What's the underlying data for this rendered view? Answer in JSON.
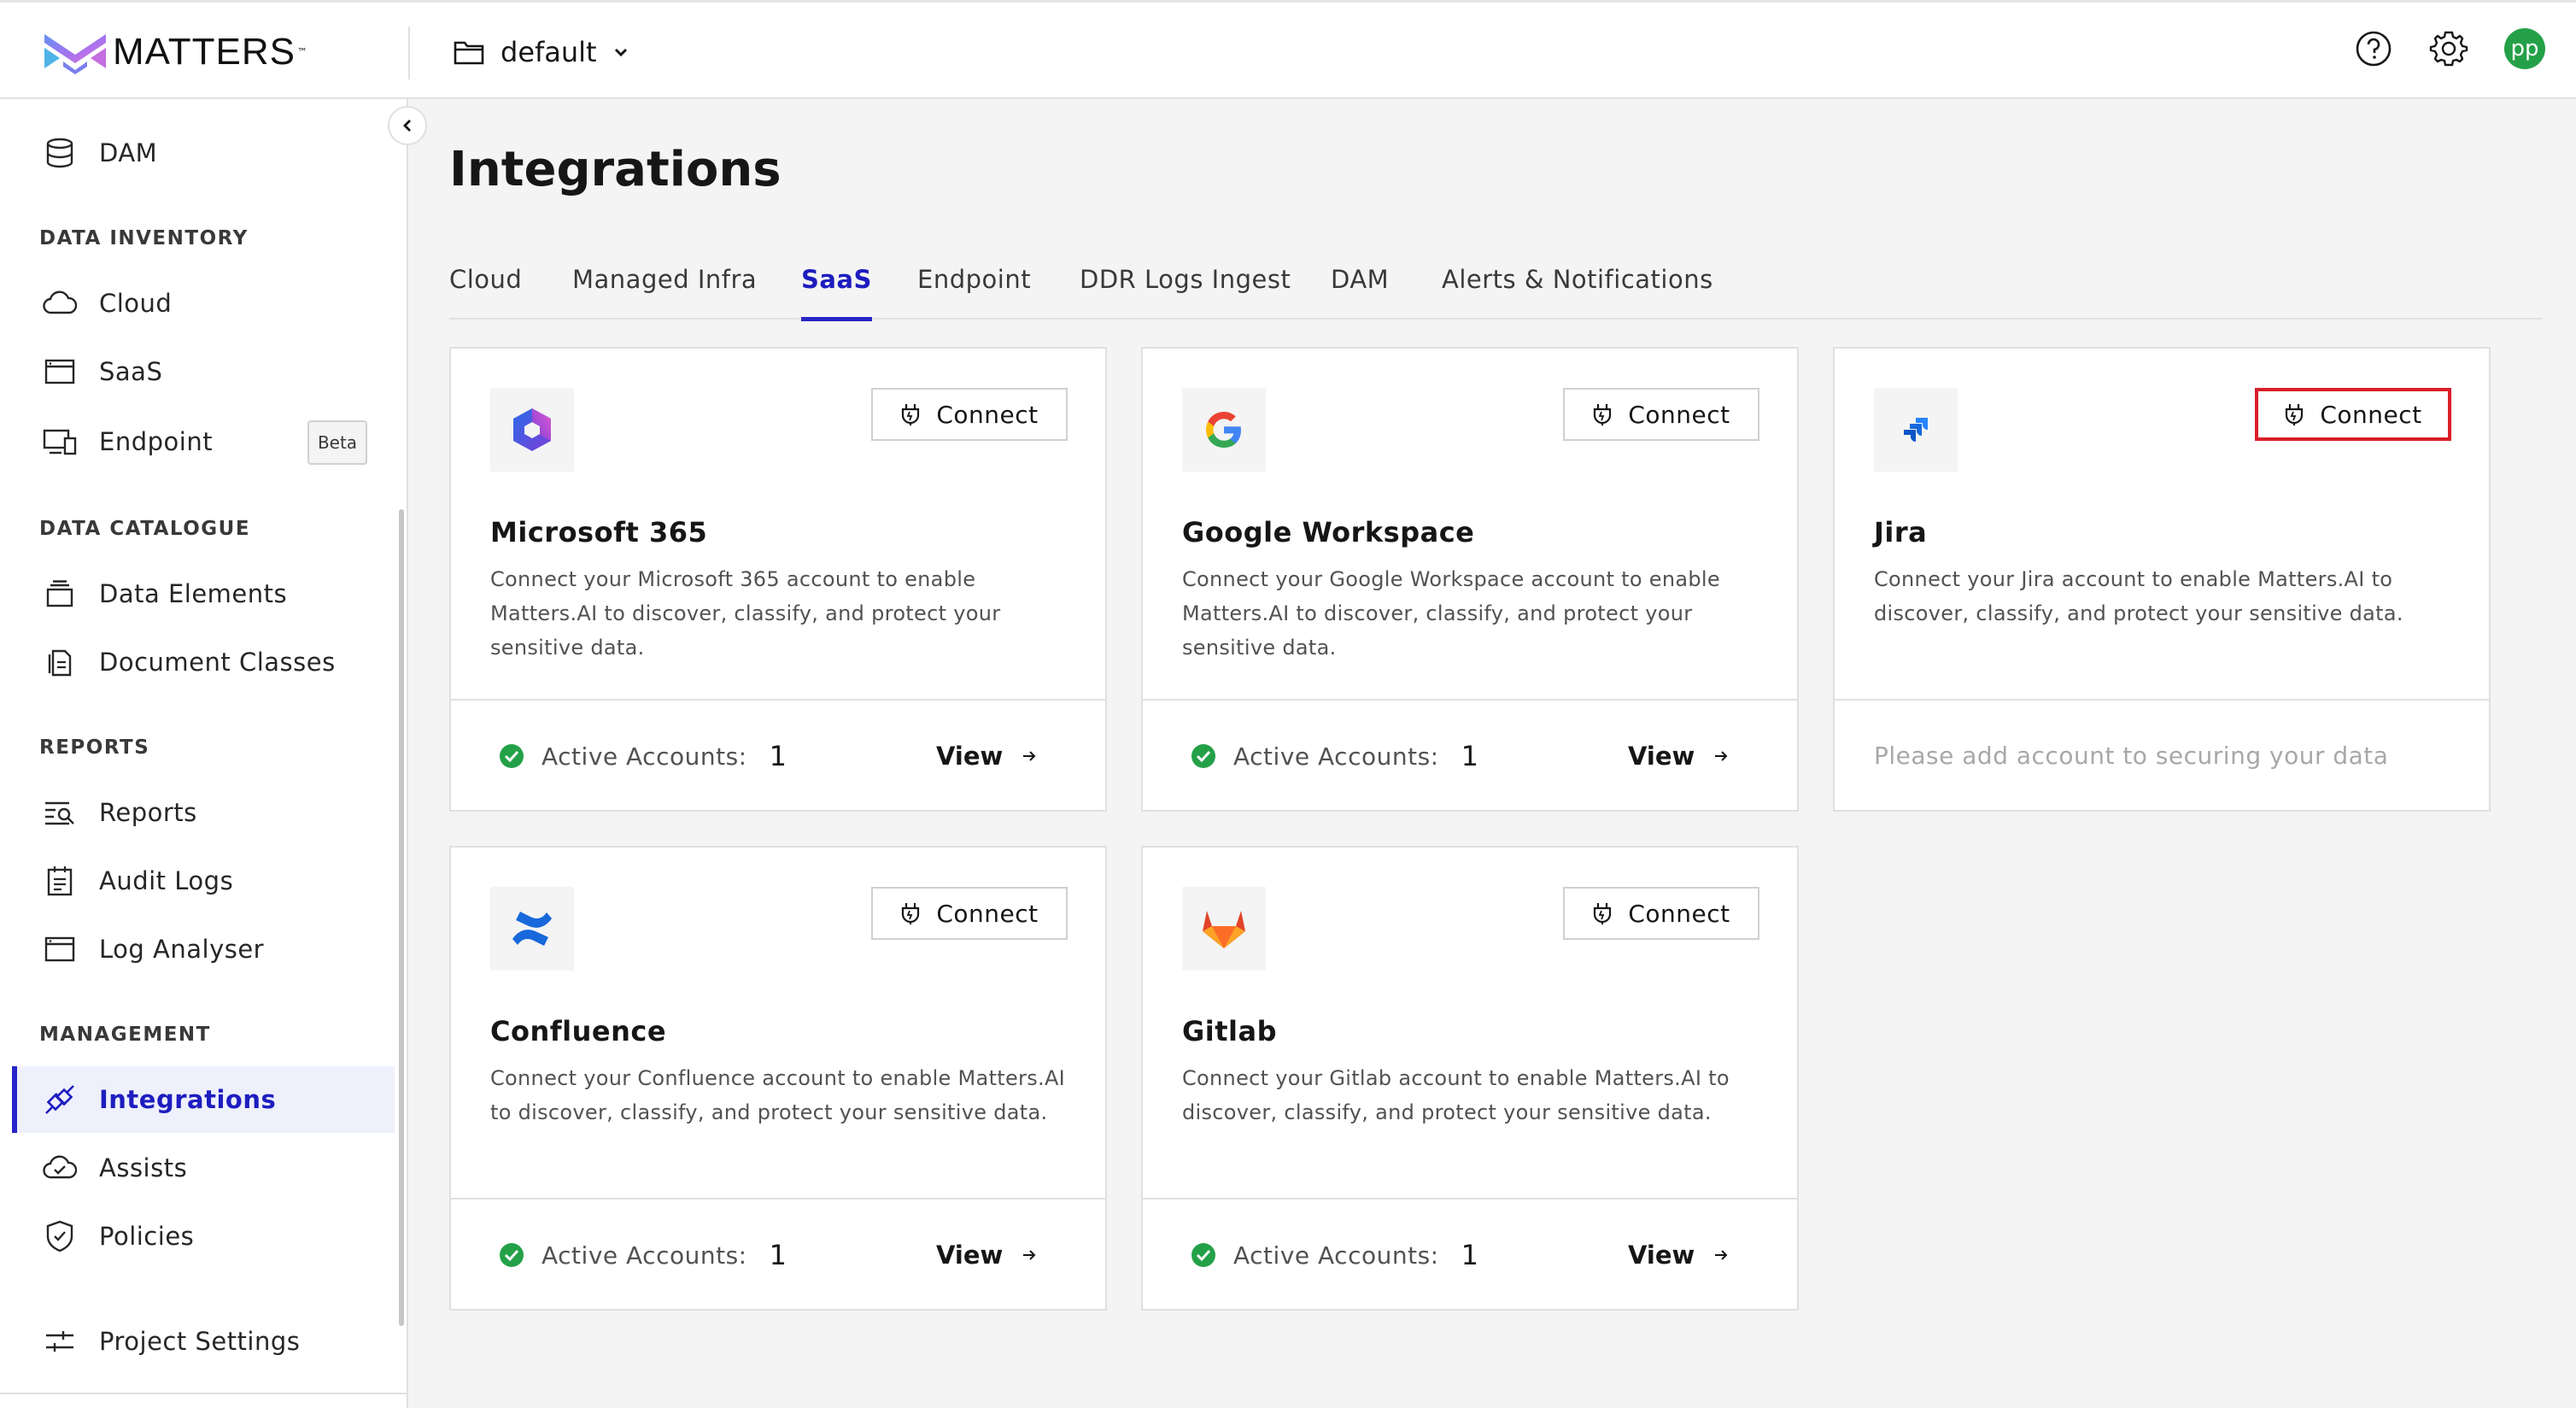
{
  "brand": {
    "name": "MATTERS",
    "tm": "™"
  },
  "header": {
    "project": "default",
    "avatar_initials": "pp"
  },
  "sidebar": {
    "top_item": "DAM",
    "sections": {
      "inventory": "DATA INVENTORY",
      "catalogue": "DATA CATALOGUE",
      "reports": "REPORTS",
      "management": "MANAGEMENT"
    },
    "items": {
      "cloud": "Cloud",
      "saas": "SaaS",
      "endpoint": "Endpoint",
      "endpoint_badge": "Beta",
      "data_elements": "Data Elements",
      "document_classes": "Document Classes",
      "reports": "Reports",
      "audit_logs": "Audit Logs",
      "log_analyser": "Log Analyser",
      "integrations": "Integrations",
      "assists": "Assists",
      "policies": "Policies",
      "project_settings": "Project Settings"
    }
  },
  "main": {
    "title": "Integrations",
    "tabs": [
      "Cloud",
      "Managed Infra",
      "SaaS",
      "Endpoint",
      "DDR Logs Ingest",
      "DAM",
      "Alerts & Notifications"
    ],
    "active_tab": "SaaS",
    "connect_label": "Connect",
    "active_accounts_label": "Active Accounts:",
    "view_label": "View",
    "cards": [
      {
        "name": "Microsoft 365",
        "desc": "Connect your Microsoft 365 account to enable Matters.AI to discover, classify, and protect your sensitive data.",
        "active_accounts": "1"
      },
      {
        "name": "Google Workspace",
        "desc": "Connect your Google Workspace account to enable Matters.AI to discover, classify, and protect your sensitive data.",
        "active_accounts": "1"
      },
      {
        "name": "Jira",
        "desc": "Connect your Jira account to enable Matters.AI to discover, classify, and protect your sensitive data.",
        "empty_message": "Please add account to securing your data"
      },
      {
        "name": "Confluence",
        "desc": "Connect your Confluence account to enable Matters.AI to discover, classify, and protect your sensitive data.",
        "active_accounts": "1"
      },
      {
        "name": "Gitlab",
        "desc": "Connect your Gitlab account to enable Matters.AI to discover, classify, and protect your sensitive data.",
        "active_accounts": "1"
      }
    ]
  },
  "colors": {
    "accent": "#2525c8",
    "success": "#24a148",
    "highlight": "#da1e28"
  }
}
